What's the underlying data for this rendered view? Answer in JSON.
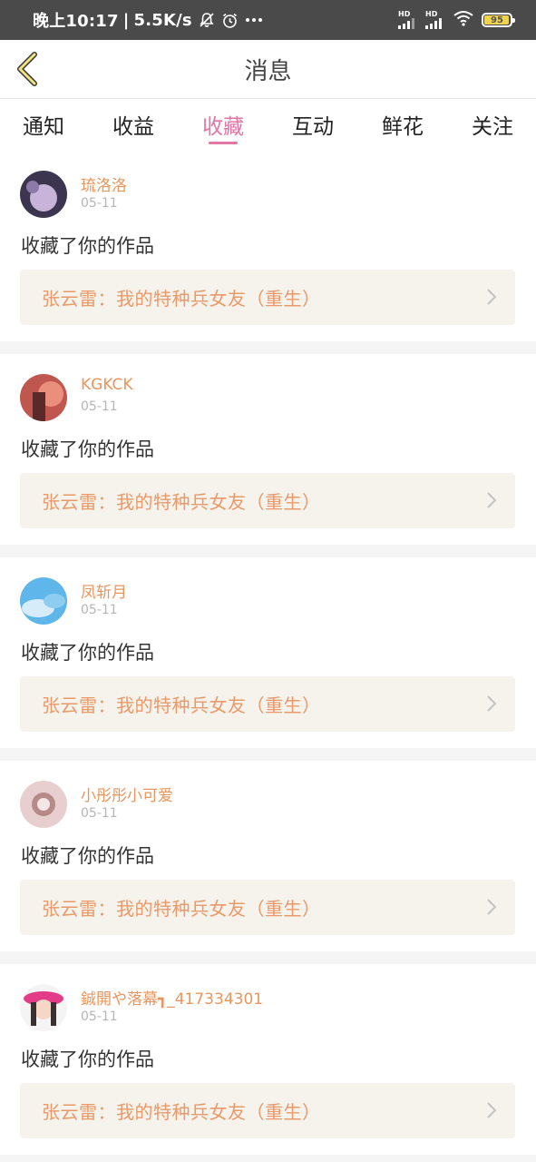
{
  "status_bar": {
    "time": "晚上10:17",
    "speed": "5.5K/s",
    "signal1_label": "HD",
    "signal2_label": "HD",
    "battery_level": 95,
    "battery_text": "95"
  },
  "header": {
    "title": "消息"
  },
  "tabs": [
    {
      "label": "通知",
      "active": false
    },
    {
      "label": "收益",
      "active": false
    },
    {
      "label": "收藏",
      "active": true
    },
    {
      "label": "互动",
      "active": false
    },
    {
      "label": "鲜花",
      "active": false
    },
    {
      "label": "关注",
      "active": false
    }
  ],
  "items": [
    {
      "username": "琉洛洛",
      "date": "05-11",
      "action": "收藏了你的作品",
      "work_title": "张云雷：我的特种兵女友（重生）",
      "avatar_colors": [
        "#3b3550",
        "#c7b4d8",
        "#8e7aa8"
      ]
    },
    {
      "username": "KGKCK",
      "date": "05-11",
      "action": "收藏了你的作品",
      "work_title": "张云雷：我的特种兵女友（重生）",
      "avatar_colors": [
        "#c0574f",
        "#e98f7c",
        "#5a2a2a"
      ]
    },
    {
      "username": "凤斩月",
      "date": "05-11",
      "action": "收藏了你的作品",
      "work_title": "张云雷：我的特种兵女友（重生）",
      "avatar_colors": [
        "#5fb6ea",
        "#d6ecf8",
        "#8fcdf0"
      ]
    },
    {
      "username": "小彤彤小可爱",
      "date": "05-11",
      "action": "收藏了你的作品",
      "work_title": "张云雷：我的特种兵女友（重生）",
      "avatar_colors": [
        "#e8cfcf",
        "#b78a8a",
        "#f4e6e6"
      ]
    },
    {
      "username": "鋮開や落幕┓_417334301",
      "date": "05-11",
      "action": "收藏了你的作品",
      "work_title": "张云雷：我的特种兵女友（重生）",
      "avatar_colors": [
        "#e33b87",
        "#f6d7c6",
        "#3a3030"
      ]
    }
  ]
}
